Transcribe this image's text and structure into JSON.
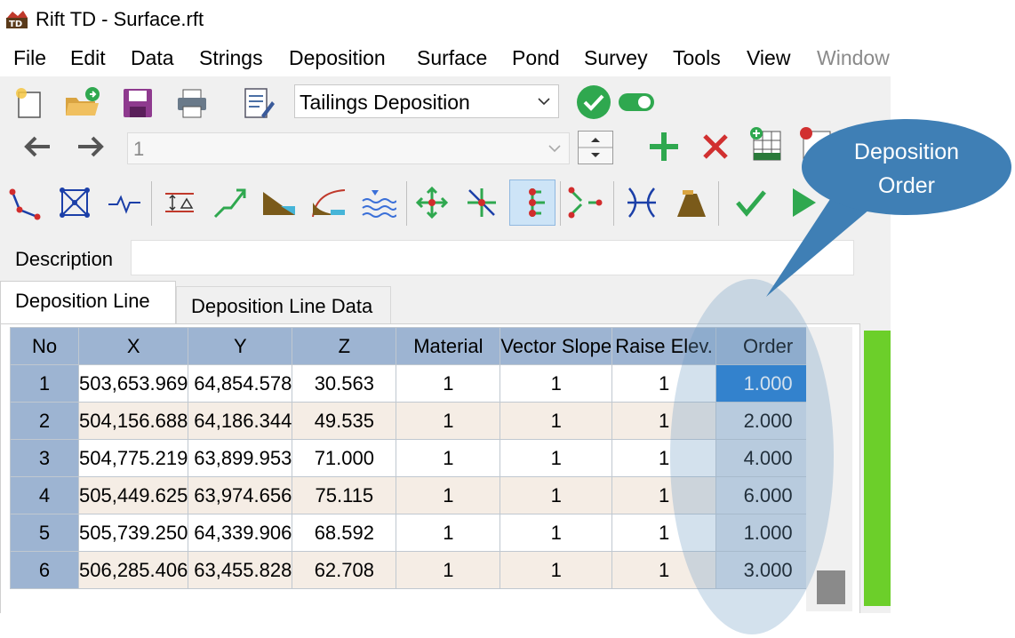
{
  "window": {
    "title": "Rift TD - Surface.rft"
  },
  "menu": [
    {
      "label": "File"
    },
    {
      "label": "Edit"
    },
    {
      "label": "Data"
    },
    {
      "label": "Strings"
    },
    {
      "label": "Deposition"
    },
    {
      "label": "Surface"
    },
    {
      "label": "Pond"
    },
    {
      "label": "Survey"
    },
    {
      "label": "Tools"
    },
    {
      "label": "View"
    },
    {
      "label": "Window"
    }
  ],
  "toolbar": {
    "mode_select": {
      "value": "Tailings Deposition"
    },
    "record_select": {
      "value": "1"
    }
  },
  "description": {
    "label": "Description",
    "value": ""
  },
  "tabs": [
    {
      "label": "Deposition Line",
      "active": true
    },
    {
      "label": "Deposition Line Data",
      "active": false
    }
  ],
  "table": {
    "columns": [
      "No",
      "X",
      "Y",
      "Z",
      "Material",
      "Vector Slope",
      "Raise Elev.",
      "Order"
    ],
    "rows": [
      {
        "no": "1",
        "x": "503,653.969",
        "y": "64,854.578",
        "z": "30.563",
        "material": "1",
        "slope": "1",
        "raise": "1",
        "order": "1.000"
      },
      {
        "no": "2",
        "x": "504,156.688",
        "y": "64,186.344",
        "z": "49.535",
        "material": "1",
        "slope": "1",
        "raise": "1",
        "order": "2.000"
      },
      {
        "no": "3",
        "x": "504,775.219",
        "y": "63,899.953",
        "z": "71.000",
        "material": "1",
        "slope": "1",
        "raise": "1",
        "order": "4.000"
      },
      {
        "no": "4",
        "x": "505,449.625",
        "y": "63,974.656",
        "z": "75.115",
        "material": "1",
        "slope": "1",
        "raise": "1",
        "order": "6.000"
      },
      {
        "no": "5",
        "x": "505,739.250",
        "y": "64,339.906",
        "z": "68.592",
        "material": "1",
        "slope": "1",
        "raise": "1",
        "order": "1.000"
      },
      {
        "no": "6",
        "x": "506,285.406",
        "y": "63,455.828",
        "z": "62.708",
        "material": "1",
        "slope": "1",
        "raise": "1",
        "order": "3.000"
      }
    ]
  },
  "callout": {
    "line1": "Deposition",
    "line2": "Order"
  },
  "colors": {
    "accent": "#1a77d2",
    "header": "#9db4d2",
    "callout": "#3f7fb5",
    "ok_green": "#2fa84f"
  }
}
